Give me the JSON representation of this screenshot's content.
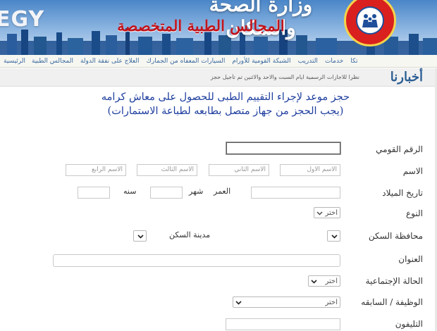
{
  "header": {
    "ministry_title": "وزارة الصحة والسكان",
    "councils_title": "المجالس الطبية المتخصصة",
    "egy_text": "EGY"
  },
  "nav": {
    "items": [
      "الرئيسية",
      "المجالس الطبية",
      "العلاج على نفقة الدولة",
      "السيارات المعفاه من الجمارك",
      "الشبكة القومية للأورام",
      "التدريب",
      "خدمات",
      "تكا"
    ]
  },
  "news": {
    "title": "أخبارنا",
    "ticker": "نظرا للاجازات الرسمية ايام السبت والاحد والاثنين تم تأجيل حجز"
  },
  "intro": {
    "line1": "حجز موعد لإجراء التقييم الطبى للحصول على معاش كرامه",
    "line2": "(يجب الحجز  من جهاز  متصل بطابعه لطباعة الاستمارات)"
  },
  "form": {
    "national_id_label": "الرقم القومي",
    "name_label": "الاسم",
    "name_placeholders": [
      "الاسم الاول",
      "الاسم الثاني",
      "الاسم الثالث",
      "الاسم الرابع"
    ],
    "dob_label": "تاريخ الميلاد",
    "age_label": "العمر",
    "month_label": "شهر",
    "year_label": "سنه",
    "gender_label": "النوع",
    "gender_value": "اختر",
    "governorate_label": "محافظة السكن",
    "city_label": "مدينة السكن",
    "address_label": "العنوان",
    "marital_label": "الحالة الإجتماعية",
    "marital_value": "اختر",
    "job_label": "الوظيفة / السابقه",
    "job_value": "اختر",
    "phone_label": "التليفون"
  },
  "colors": {
    "banner_top": "#4a86c8",
    "councils_red": "#c0141c",
    "link_blue": "#3a6a9e",
    "intro_blue": "#1f3f9f"
  }
}
